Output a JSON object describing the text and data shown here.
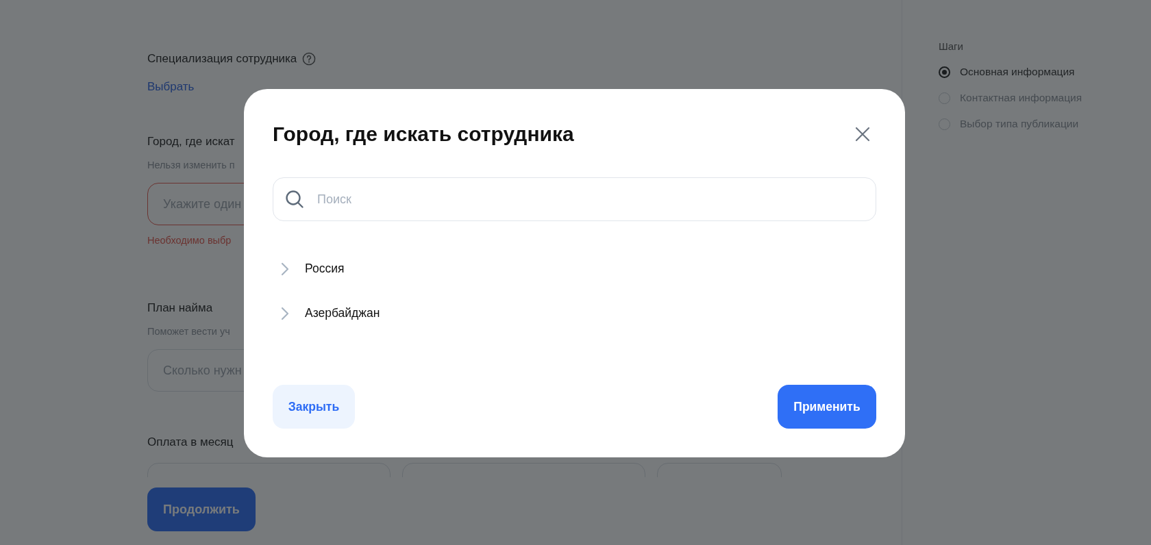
{
  "form": {
    "specialization": {
      "label": "Специализация сотрудника",
      "link": "Выбрать"
    },
    "city": {
      "label": "Город, где искат",
      "hint": "Нельзя изменить п",
      "placeholder": "Укажите один",
      "error": "Необходимо выбр"
    },
    "plan": {
      "label": "План найма",
      "hint": "Поможет вести уч",
      "placeholder": "Сколько нужн"
    },
    "salary": {
      "label": "Оплата в месяц"
    }
  },
  "continue_button": "Продолжить",
  "steps": {
    "title": "Шаги",
    "items": [
      {
        "label": "Основная информация",
        "selected": true
      },
      {
        "label": "Контактная информация",
        "selected": false
      },
      {
        "label": "Выбор типа публикации",
        "selected": false
      }
    ]
  },
  "modal": {
    "title": "Город, где искать сотрудника",
    "search": {
      "placeholder": "Поиск"
    },
    "items": [
      {
        "label": "Россия",
        "expanded": false
      },
      {
        "label": "Азербайджан",
        "expanded": false
      }
    ],
    "buttons": {
      "close": "Закрыть",
      "apply": "Применить"
    }
  }
}
